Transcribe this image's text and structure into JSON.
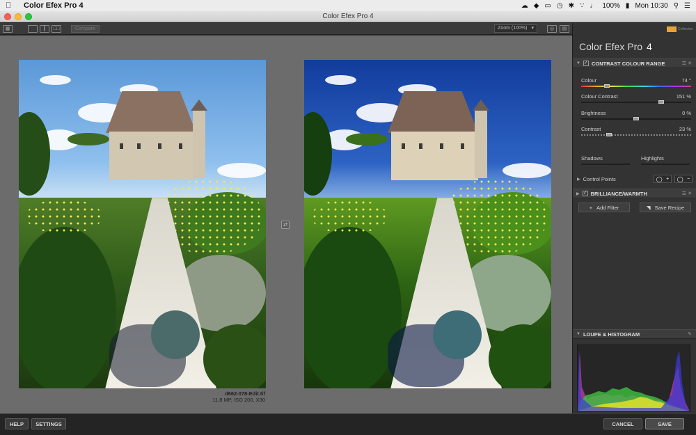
{
  "menubar": {
    "app_name": "Color Efex Pro 4",
    "battery": "100%",
    "clock": "Mon 10:30"
  },
  "window": {
    "title": "Color Efex Pro 4"
  },
  "toolbar": {
    "compare_label": "Compare",
    "zoom_label": "Zoom (100%)"
  },
  "image": {
    "filename": "d662-078-Edit.tif",
    "meta": "11.8 MP, ISO 200, X30"
  },
  "panel": {
    "app_title": "Color Efex Pro",
    "app_version": "4",
    "brand": "Collection",
    "filter1": {
      "title": "CONTRAST COLOUR RANGE",
      "sliders": [
        {
          "label": "Colour",
          "value": "74 °",
          "level": 0.22
        },
        {
          "label": "Colour Contrast",
          "value": "151 %",
          "level": 0.74
        },
        {
          "label": "Brightness",
          "value": "0 %",
          "level": 0.5
        },
        {
          "label": "Contrast",
          "value": "23 %",
          "level": 0.24
        }
      ],
      "shadows_label": "Shadows",
      "highlights_label": "Highlights",
      "control_points_label": "Control Points"
    },
    "filter2": {
      "title": "BRILLIANCE/WARMTH"
    },
    "add_filter_label": "Add Filter",
    "save_recipe_label": "Save Recipe",
    "loupe_title": "LOUPE & HISTOGRAM"
  },
  "bottom": {
    "help_label": "HELP",
    "settings_label": "SETTINGS",
    "cancel_label": "CANCEL",
    "save_label": "SAVE"
  }
}
